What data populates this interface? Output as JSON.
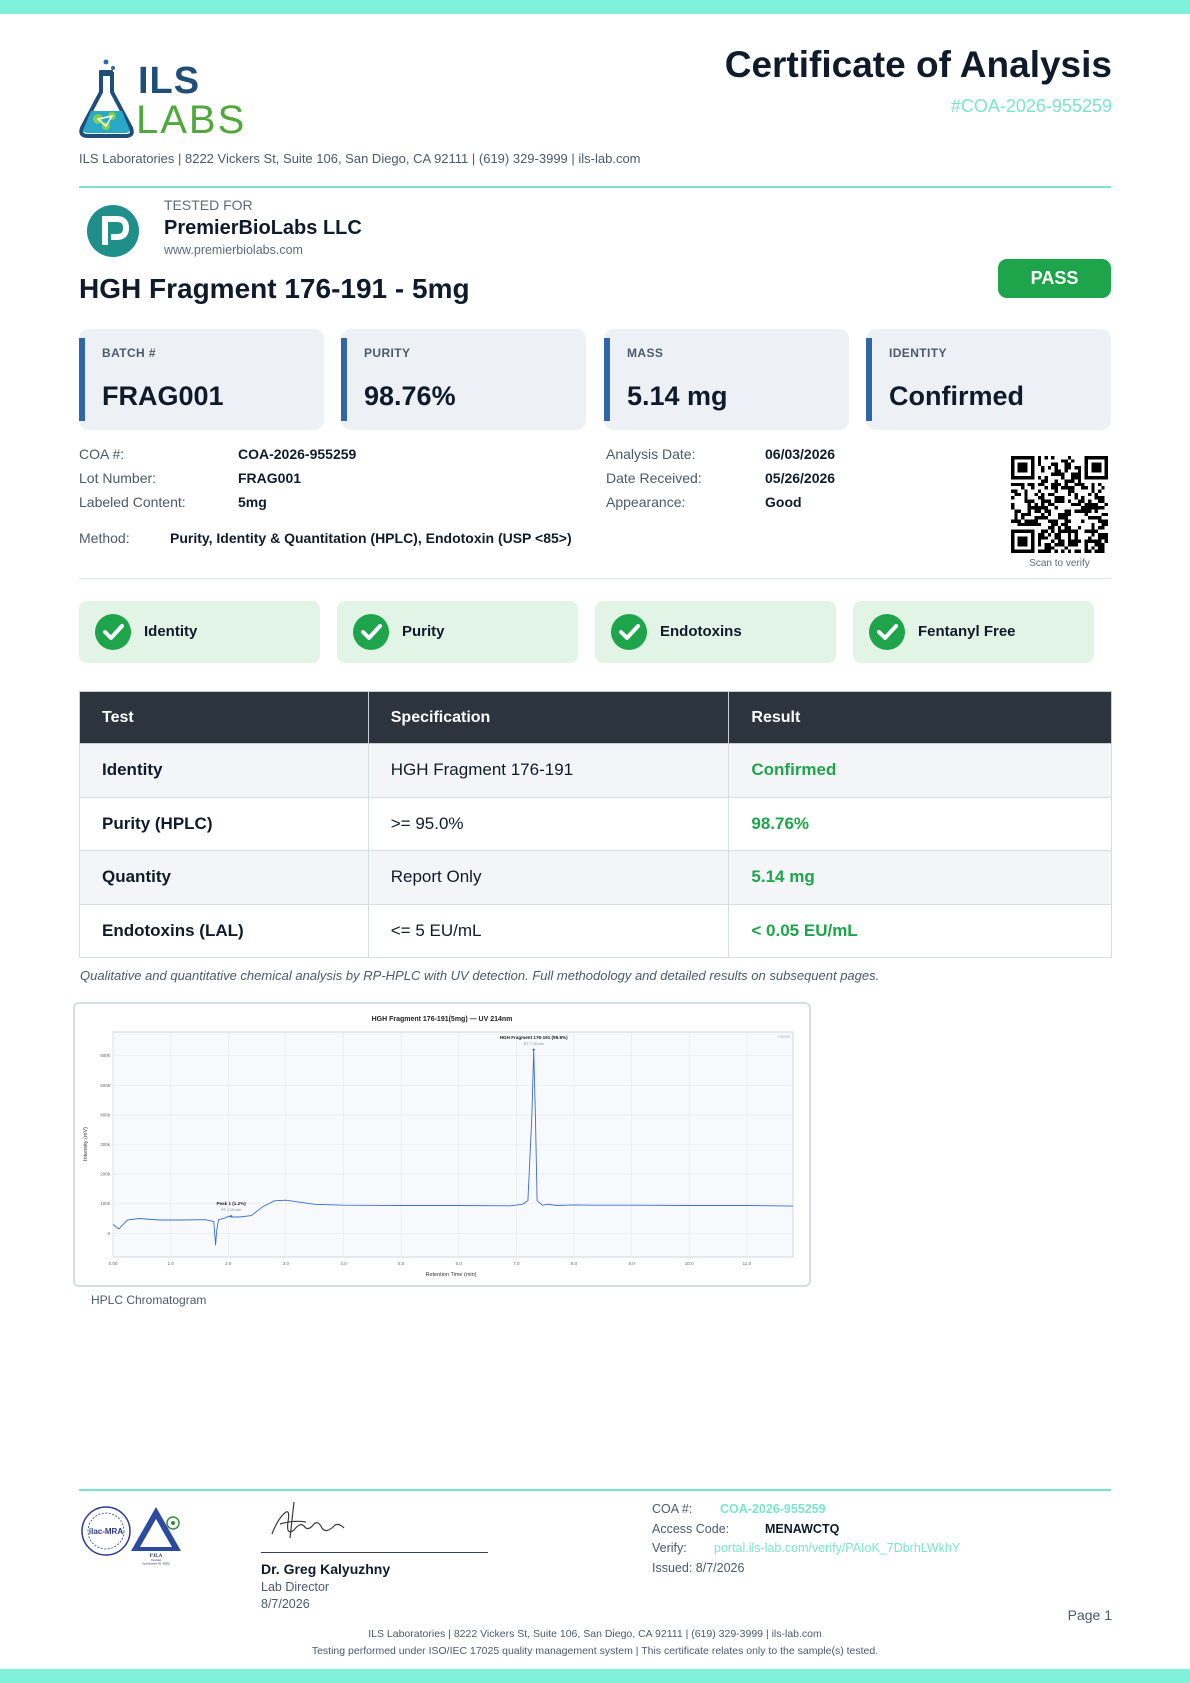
{
  "header": {
    "logo_top": "ILS",
    "logo_bottom": "LABS",
    "title": "Certificate of Analysis",
    "coa_id": "#COA-2026-955259",
    "address_line": "ILS Laboratories  |  8222 Vickers St, Suite 106, San Diego, CA 92111  |  (619) 329-3999  |  ils-lab.com"
  },
  "client": {
    "tested_for_label": "TESTED FOR",
    "name": "PremierBioLabs LLC",
    "website": "www.premierbiolabs.com"
  },
  "product": {
    "name": "HGH Fragment 176-191 - 5mg",
    "status": "PASS"
  },
  "stats": [
    {
      "label": "BATCH #",
      "value": "FRAG001"
    },
    {
      "label": "PURITY",
      "value": "98.76%"
    },
    {
      "label": "MASS",
      "value": "5.14 mg"
    },
    {
      "label": "IDENTITY",
      "value": "Confirmed"
    }
  ],
  "details": {
    "left": [
      {
        "label": "COA #:",
        "value": "COA-2026-955259"
      },
      {
        "label": "Lot Number:",
        "value": "FRAG001"
      },
      {
        "label": "Labeled Content:",
        "value": "5mg"
      }
    ],
    "right": [
      {
        "label": "Analysis Date:",
        "value": "06/03/2026"
      },
      {
        "label": "Date Received:",
        "value": "05/26/2026"
      },
      {
        "label": "Appearance:",
        "value": "Good"
      }
    ],
    "method_label": "Method:",
    "method_value": "Purity, Identity & Quantitation (HPLC), Endotoxin (USP <85>)",
    "scan_label": "Scan to verify"
  },
  "checks": [
    "Identity",
    "Purity",
    "Endotoxins",
    "Fentanyl Free"
  ],
  "table": {
    "headers": [
      "Test",
      "Specification",
      "Result"
    ],
    "rows": [
      [
        "Identity",
        "HGH Fragment 176-191",
        "Confirmed"
      ],
      [
        "Purity (HPLC)",
        ">= 95.0%",
        "98.76%"
      ],
      [
        "Quantity",
        "Report Only",
        "5.14 mg"
      ],
      [
        "Endotoxins (LAL)",
        "<= 5 EU/mL",
        "< 0.05 EU/mL"
      ]
    ]
  },
  "note": "Qualitative and quantitative chemical analysis by RP-HPLC with UV detection. Full methodology and detailed results on subsequent pages.",
  "chart_data": {
    "type": "line",
    "title": "HGH Fragment 176-191(5mg) — UV 214nm",
    "xlabel": "Retention Time (min)",
    "ylabel": "Intensity (mV)",
    "corner_label": "7/3/4/4",
    "xlim": [
      0,
      11.8
    ],
    "ylim": [
      -80000,
      680000
    ],
    "x_ticks": [
      "0.00",
      "1.0",
      "2.0",
      "3.0",
      "4.0",
      "5.0",
      "6.0",
      "7.0",
      "8.0",
      "9.0",
      "10.0",
      "11.0"
    ],
    "y_ticks": [
      "0",
      "100k",
      "200k",
      "300k",
      "400k",
      "500k",
      "600k"
    ],
    "y_tick_values": [
      0,
      100000,
      200000,
      300000,
      400000,
      500000,
      600000
    ],
    "series": [
      {
        "x": [
          0,
          0.1,
          0.25,
          0.45,
          0.8,
          1.2,
          1.6,
          1.75,
          1.78,
          1.8,
          1.83,
          1.87,
          1.95,
          2.0,
          2.05,
          2.2,
          2.4,
          2.6,
          2.8,
          3.0,
          3.5,
          4.0,
          5.0,
          6.0,
          6.9,
          7.1,
          7.2,
          7.27,
          7.3,
          7.33,
          7.36,
          7.45,
          7.55,
          7.7,
          8.0,
          8.3,
          9.0,
          10.0,
          11.0,
          11.8
        ],
        "y": [
          30000,
          15000,
          45000,
          50000,
          45000,
          45000,
          46000,
          40000,
          -40000,
          10000,
          45000,
          48000,
          52000,
          58000,
          55000,
          55000,
          60000,
          90000,
          110000,
          112000,
          98000,
          95000,
          94000,
          94000,
          93000,
          98000,
          110000,
          400000,
          620000,
          400000,
          110000,
          95000,
          98000,
          94000,
          96000,
          95000,
          95000,
          94000,
          94000,
          92000
        ]
      }
    ],
    "annotations": [
      {
        "text": "HGH Fragment 176-191 (98.8%)",
        "sub": "RT: 7.28 min",
        "x": 7.3,
        "y": 620000
      },
      {
        "text": "Peak 1 (1.2%)",
        "sub": "RT: 2.05 min",
        "x": 2.05,
        "y": 58000
      }
    ],
    "caption": "HPLC Chromatogram"
  },
  "footer": {
    "seal_left_text": "ilac-MRA",
    "seal_right_text": "PJLA",
    "seal_right_sub": "Testing",
    "seal_right_acc": "Accreditation No. 99652",
    "signer_name": "Dr. Greg Kalyuzhny",
    "signer_role": "Lab Director",
    "signer_date": "8/7/2026",
    "coa_label": "COA #:",
    "coa_value": "COA-2026-955259",
    "access_label": "Access Code:",
    "access_value": "MENAWCTQ",
    "verify_label": "Verify:",
    "verify_value": "portal.ils-lab.com/verify/PAIoK_7DbrhLWkhY",
    "issued": "Issued: 8/7/2026",
    "page": "Page 1",
    "line1": "ILS Laboratories  |  8222 Vickers St, Suite 106, San Diego, CA 92111  |  (619) 329-3999  |  ils-lab.com",
    "line2": "Testing performed under ISO/IEC 17025 quality management system  |  This certificate relates only to the sample(s) tested."
  },
  "colors": {
    "band": "#80f2dc",
    "accent_teal": "#7ae3d0",
    "pass_green": "#1ea44b",
    "card_bar": "#2e66a8",
    "table_header": "#2c343e",
    "trace": "#3a6fc9"
  },
  "icons": [
    "ils-flask-logo",
    "client-p-logo",
    "qr-code-icon",
    "check-icon",
    "ilac-mra-seal",
    "pjla-seal",
    "signature"
  ]
}
